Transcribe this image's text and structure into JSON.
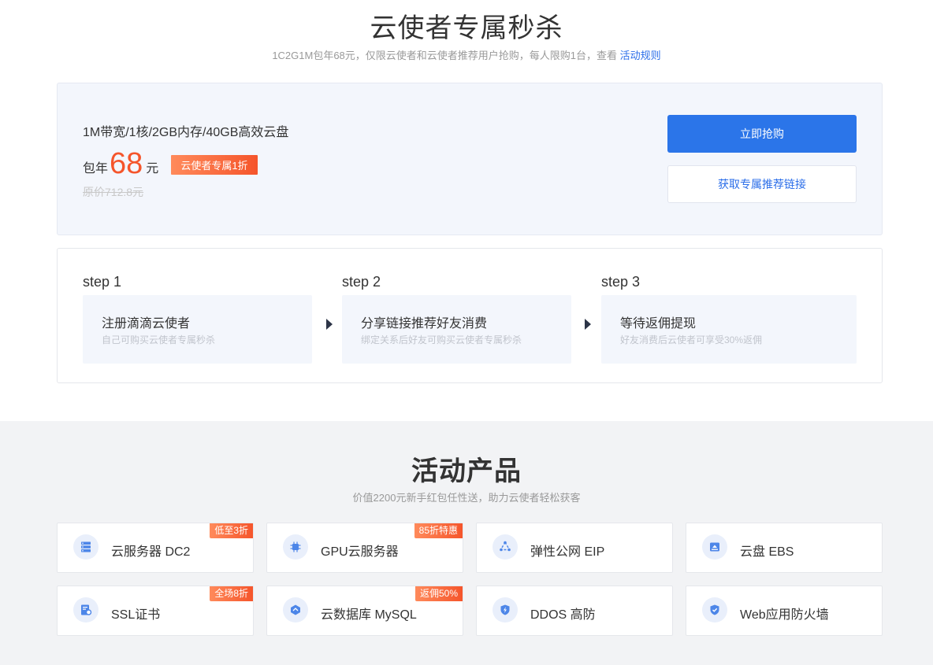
{
  "header": {
    "title": "云使者专属秒杀",
    "subtitle_text": "1C2G1M包年68元，仅限云使者和云使者推荐用户抢购，每人限购1台，查看",
    "rules_link": "活动规则"
  },
  "offer": {
    "spec": "1M带宽/1核/2GB内存/40GB高效云盘",
    "price_prefix": "包年",
    "price": "68",
    "price_unit": "元",
    "discount_badge": "云使者专属1折",
    "original_price": "原价712.8元",
    "buy_button": "立即抢购",
    "link_button": "获取专属推荐链接"
  },
  "steps": [
    {
      "label": "step 1",
      "title": "注册滴滴云使者",
      "desc": "自己可购买云使者专属秒杀"
    },
    {
      "label": "step 2",
      "title": "分享链接推荐好友消费",
      "desc": "绑定关系后好友可购买云使者专属秒杀"
    },
    {
      "label": "step 3",
      "title": "等待返佣提现",
      "desc": "好友消费后云使者可享受30%返佣"
    }
  ],
  "products_section": {
    "title": "活动产品",
    "subtitle": "价值2200元新手红包任性送，助力云使者轻松获客",
    "items": [
      {
        "name": "云服务器 DC2",
        "tag": "低至3折",
        "icon": "server-icon"
      },
      {
        "name": "GPU云服务器",
        "tag": "85折特惠",
        "icon": "chip-icon"
      },
      {
        "name": "弹性公网 EIP",
        "tag": "",
        "icon": "network-icon"
      },
      {
        "name": "云盘 EBS",
        "tag": "",
        "icon": "disk-icon"
      },
      {
        "name": "SSL证书",
        "tag": "全场8折",
        "icon": "certificate-icon"
      },
      {
        "name": "云数据库 MySQL",
        "tag": "返佣50%",
        "icon": "database-icon"
      },
      {
        "name": "DDOS 高防",
        "tag": "",
        "icon": "shield-bolt-icon"
      },
      {
        "name": "Web应用防火墙",
        "tag": "",
        "icon": "firewall-icon"
      }
    ]
  },
  "colors": {
    "accent": "#2b75e9",
    "price": "#f5552b",
    "tag": "#f5552b",
    "panel": "#f3f6fc",
    "section_bg": "#f2f3f5"
  }
}
